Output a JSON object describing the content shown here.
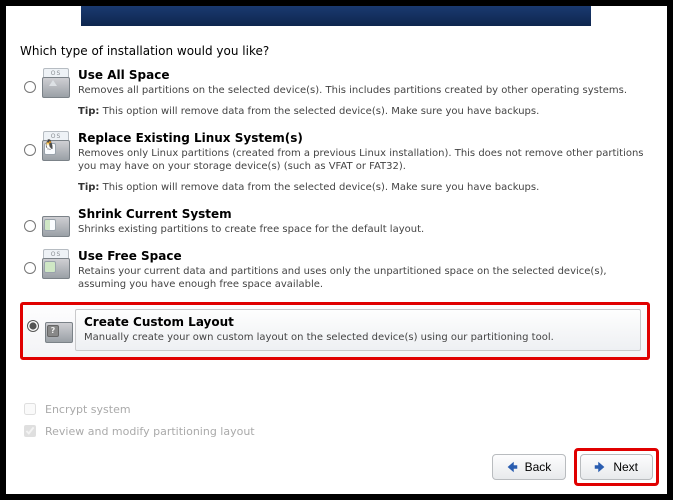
{
  "prompt": "Which type of installation would you like?",
  "options": {
    "use_all": {
      "title": "Use All Space",
      "desc": "Removes all partitions on the selected device(s).  This includes partitions created by other operating systems.",
      "tip_label": "Tip:",
      "tip": "This option will remove data from the selected device(s).  Make sure you have backups."
    },
    "replace_linux": {
      "title": "Replace Existing Linux System(s)",
      "desc": "Removes only Linux partitions (created from a previous Linux installation).  This does not remove other partitions you may have on your storage device(s) (such as VFAT or FAT32).",
      "tip_label": "Tip:",
      "tip": "This option will remove data from the selected device(s).  Make sure you have backups."
    },
    "shrink": {
      "title": "Shrink Current System",
      "desc": "Shrinks existing partitions to create free space for the default layout."
    },
    "use_free": {
      "title": "Use Free Space",
      "desc": "Retains your current data and partitions and uses only the unpartitioned space on the selected device(s), assuming you have enough free space available."
    },
    "custom": {
      "title": "Create Custom Layout",
      "desc": "Manually create your own custom layout on the selected device(s) using our partitioning tool."
    }
  },
  "checks": {
    "encrypt": "Encrypt system",
    "review": "Review and modify partitioning layout"
  },
  "buttons": {
    "back": "Back",
    "next": "Next"
  },
  "icon_os_label": "OS",
  "icon_q_label": "?"
}
